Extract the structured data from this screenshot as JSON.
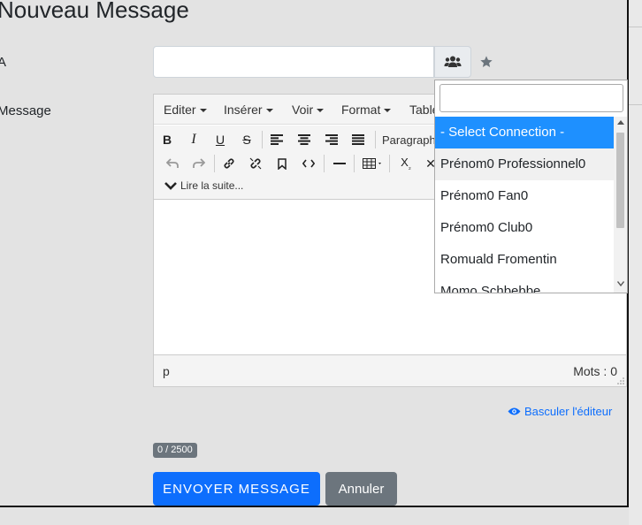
{
  "page": {
    "title": "Nouveau Message"
  },
  "form": {
    "to_label": "A",
    "message_label": "Message",
    "to_value": ""
  },
  "editor": {
    "menu": [
      "Editer",
      "Insérer",
      "Voir",
      "Format",
      "Table"
    ],
    "paragraph_label": "Paragraph",
    "read_more": "Lire la suite...",
    "status_element": "p",
    "word_count": "Mots : 0"
  },
  "toggle_editor_label": "Basculer l'éditeur",
  "counter": "0 / 2500",
  "buttons": {
    "send": "ENVOYER MESSAGE",
    "cancel": "Annuler"
  },
  "dropdown": {
    "search_value": "",
    "options": [
      "- Select Connection -",
      "Prénom0 Professionnel0",
      "Prénom0 Fan0",
      "Prénom0 Club0",
      "Romuald Fromentin",
      "Momo Schbebbe"
    ]
  },
  "colors": {
    "primary": "#0d6efd",
    "selected": "#1e90ff",
    "secondary": "#6c757d"
  }
}
